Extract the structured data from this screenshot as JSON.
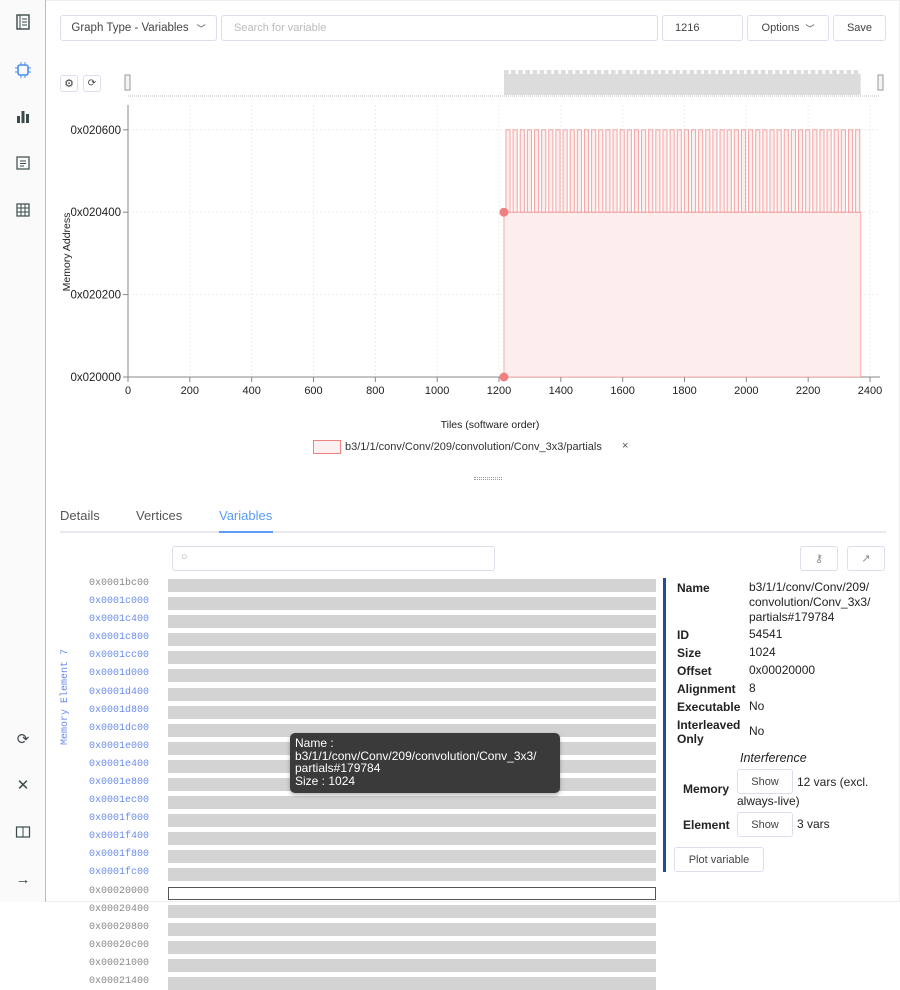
{
  "sidebar": {
    "icons": [
      "notebook-icon",
      "chip-icon",
      "bar-chart-icon",
      "document-icon",
      "table-icon",
      "refresh-icon",
      "close-icon",
      "book-icon",
      "arrow-right-icon"
    ]
  },
  "toolbar": {
    "graph_type": "Graph Type - Variables",
    "search_placeholder": "Search for variable",
    "tile_value": "1216",
    "options_label": "Options",
    "save_label": "Save"
  },
  "chart_data": {
    "type": "area",
    "xlabel": "Tiles  (software order)",
    "ylabel": "Memory Address",
    "xlim": [
      0,
      2400
    ],
    "xticks": [
      0,
      200,
      400,
      600,
      800,
      1000,
      1200,
      1400,
      1600,
      1800,
      2000,
      2200,
      2400
    ],
    "yticks": [
      "0x020000",
      "0x020200",
      "0x020400",
      "0x020600"
    ],
    "yvalues": [
      131072,
      131584,
      132096,
      132608
    ],
    "grid": true,
    "legend_placement": "bottom",
    "accent": "#f08080",
    "series": [
      {
        "name": "b3/1/1/conv/Conv/209/convolution/Conv_3x3/partials",
        "x_start": 1216,
        "x_end": 2370,
        "y_base": 131072,
        "y_low": 132096,
        "y_high": 132608,
        "pulses": 50
      }
    ],
    "markers": [
      {
        "x": 1216,
        "y": 132096
      },
      {
        "x": 1216,
        "y": 131072
      }
    ]
  },
  "legend": {
    "label": "b3/1/1/conv/Conv/209/convolution/Conv_3x3/partials",
    "close": "×"
  },
  "tabs": [
    {
      "label": "Details"
    },
    {
      "label": "Vertices"
    },
    {
      "label": "Variables",
      "active": true
    }
  ],
  "memory": {
    "group_label": "Memory Element 7",
    "rows": [
      {
        "addr": "0x0001bc00",
        "blue": false
      },
      {
        "addr": "0x0001c000",
        "blue": true
      },
      {
        "addr": "0x0001c400",
        "blue": true
      },
      {
        "addr": "0x0001c800",
        "blue": true
      },
      {
        "addr": "0x0001cc00",
        "blue": true
      },
      {
        "addr": "0x0001d000",
        "blue": true
      },
      {
        "addr": "0x0001d400",
        "blue": true
      },
      {
        "addr": "0x0001d800",
        "blue": true
      },
      {
        "addr": "0x0001dc00",
        "blue": true
      },
      {
        "addr": "0x0001e000",
        "blue": true
      },
      {
        "addr": "0x0001e400",
        "blue": true
      },
      {
        "addr": "0x0001e800",
        "blue": true
      },
      {
        "addr": "0x0001ec00",
        "blue": true
      },
      {
        "addr": "0x0001f000",
        "blue": true
      },
      {
        "addr": "0x0001f400",
        "blue": true
      },
      {
        "addr": "0x0001f800",
        "blue": true
      },
      {
        "addr": "0x0001fc00",
        "blue": true
      },
      {
        "addr": "0x00020000",
        "blue": false,
        "selected": true
      },
      {
        "addr": "0x00020400",
        "blue": false
      },
      {
        "addr": "0x00020800",
        "blue": false
      },
      {
        "addr": "0x00020c00",
        "blue": false
      },
      {
        "addr": "0x00021000",
        "blue": false
      },
      {
        "addr": "0x00021400",
        "blue": false
      }
    ]
  },
  "tooltip": {
    "line1": "Name :",
    "line2": "b3/1/1/conv/Conv/209/convolution/Conv_3x3/",
    "line3": "partials#179784",
    "line4": "Size : 1024"
  },
  "details": {
    "name_label": "Name",
    "name_value": "b3/1/1/conv/Conv/209/convolution/Conv_3x3/partials#179784",
    "id_label": "ID",
    "id_value": "54541",
    "size_label": "Size",
    "size_value": "1024",
    "offset_label": "Offset",
    "offset_value": "0x00020000",
    "alignment_label": "Alignment",
    "alignment_value": "8",
    "executable_label": "Executable",
    "executable_value": "No",
    "interleaved_label": "Interleaved Only",
    "interleaved_value": "No",
    "interference_title": "Interference",
    "memory_label": "Memory",
    "memory_show": "Show",
    "memory_text": "12 vars (excl. always-live)",
    "element_label": "Element",
    "element_show": "Show",
    "element_text": "3 vars",
    "plot_label": "Plot variable",
    "accent": "#1f4e9c"
  }
}
